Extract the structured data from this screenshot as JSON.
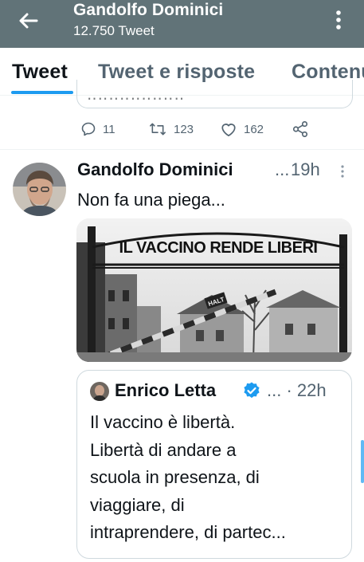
{
  "header": {
    "back_icon": "arrow-left-icon",
    "title": "Gandolfo Dominici",
    "subtitle": "12.750 Tweet",
    "more_icon": "more-vertical-icon",
    "bar_color": "#617378"
  },
  "tabs": [
    {
      "label": "Tweet",
      "active": true
    },
    {
      "label": "Tweet e risposte",
      "active": false
    },
    {
      "label": "Contenuti multimediali",
      "active": false
    }
  ],
  "accent_color": "#1d9bf0",
  "previous_tweet": {
    "replies": "11",
    "retweets": "123",
    "likes": "162"
  },
  "tweet": {
    "author": "Gandolfo Dominici",
    "ellipsis": "...",
    "time": "19h",
    "text": "Non fa una piega...",
    "media": {
      "gate_text": "IL VACCINO RENDE LIBERI",
      "sign_text": "HALT"
    },
    "quoted": {
      "author": "Enrico Letta",
      "verified": true,
      "meta": "... · 22h",
      "lines": [
        "Il vaccino è libertà.",
        "Libertà di andare a",
        "scuola in presenza, di",
        "viaggiare, di",
        "intraprendere, di partec..."
      ]
    }
  }
}
